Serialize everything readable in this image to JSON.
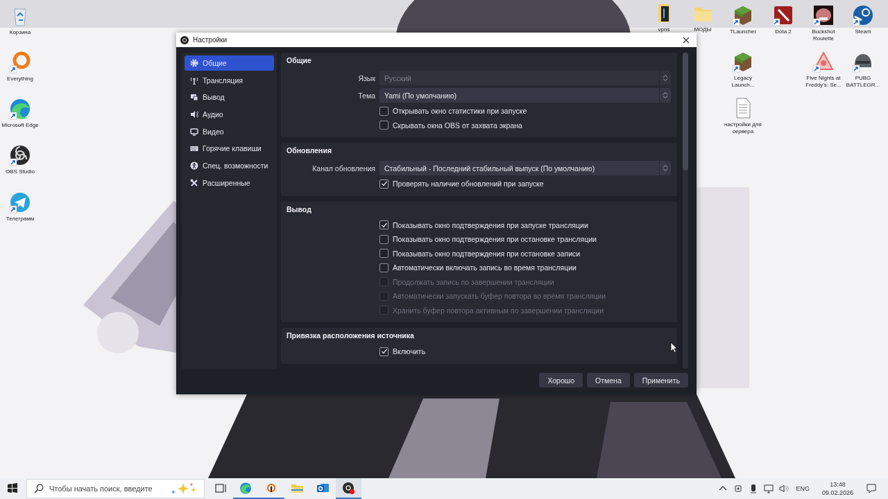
{
  "desktop_icons": [
    {
      "label": "Корзина",
      "kind": "recycle",
      "shortcut": false
    },
    {
      "label": "Everything",
      "kind": "ring",
      "shortcut": true
    },
    {
      "label": "Microsoft Edge",
      "kind": "wave",
      "shortcut": true
    },
    {
      "label": "OBS Studio",
      "kind": "blades",
      "shortcut": true
    },
    {
      "label": "Телеграмм",
      "kind": "plane",
      "shortcut": true
    },
    {
      "label": "vpns",
      "kind": "book",
      "shortcut": false
    },
    {
      "label": "МОДЫ",
      "kind": "folder",
      "shortcut": false
    },
    {
      "label": "TLauncher",
      "kind": "block",
      "shortcut": true
    },
    {
      "label": "Dota 2",
      "kind": "redtile",
      "shortcut": true
    },
    {
      "label": "Buckshot Roulette",
      "kind": "emblem",
      "shortcut": true
    },
    {
      "label": "Steam",
      "kind": "piston",
      "shortcut": true
    },
    {
      "label": "Legacy Launch...",
      "kind": "block",
      "shortcut": true
    },
    {
      "label": "Five Nights at Freddy's: Se...",
      "kind": "triangle",
      "shortcut": true
    },
    {
      "label": "PUBG BATTLEGR...",
      "kind": "helmet",
      "shortcut": true
    },
    {
      "label": "настройки для сервера",
      "kind": "document",
      "shortcut": false
    }
  ],
  "settings_window": {
    "title": "Настройки",
    "sidebar": [
      {
        "label": "Общие",
        "kind": "gear",
        "selected": true
      },
      {
        "label": "Трансляция",
        "kind": "antenna",
        "selected": false
      },
      {
        "label": "Вывод",
        "kind": "output",
        "selected": false
      },
      {
        "label": "Аудио",
        "kind": "speaker",
        "selected": false
      },
      {
        "label": "Видео",
        "kind": "monitor",
        "selected": false
      },
      {
        "label": "Горячие клавиши",
        "kind": "keyboard",
        "selected": false
      },
      {
        "label": "Спец. возможности",
        "kind": "person",
        "selected": false
      },
      {
        "label": "Расширенные",
        "kind": "tools",
        "selected": false
      }
    ],
    "sections": [
      {
        "title": "Общие",
        "rows": [
          {
            "kind": "select",
            "label": "Язык",
            "value": "Русский",
            "disabled": true
          },
          {
            "kind": "select",
            "label": "Тема",
            "value": "Yami (По умолчанию)",
            "disabled": false
          },
          {
            "kind": "checkbox",
            "label": "Открывать окно статистики при запуске",
            "checked": false,
            "disabled": false
          },
          {
            "kind": "checkbox",
            "label": "Скрывать окна OBS от захвата экрана",
            "checked": false,
            "disabled": false
          }
        ]
      },
      {
        "title": "Обновления",
        "rows": [
          {
            "kind": "select",
            "label": "Канал обновления",
            "value": "Стабильный - Последний стабильный выпуск (По умолчанию)",
            "disabled": false
          },
          {
            "kind": "checkbox",
            "label": "Проверять наличие обновлений при запуске",
            "checked": true,
            "disabled": false
          }
        ]
      },
      {
        "title": "Вывод",
        "rows": [
          {
            "kind": "checkbox",
            "label": "Показывать окно подтверждения при запуске трансляции",
            "checked": true,
            "disabled": false
          },
          {
            "kind": "checkbox",
            "label": "Показывать окно подтверждения при остановке трансляции",
            "checked": false,
            "disabled": false
          },
          {
            "kind": "checkbox",
            "label": "Показывать окно подтверждения при остановке записи",
            "checked": false,
            "disabled": false
          },
          {
            "kind": "checkbox",
            "label": "Автоматически включать запись во время трансляции",
            "checked": false,
            "disabled": false
          },
          {
            "kind": "checkbox",
            "label": "Продолжать запись по завершении трансляции",
            "checked": false,
            "disabled": true
          },
          {
            "kind": "checkbox",
            "label": "Автоматически запускать буфер повтора во время трансляции",
            "checked": false,
            "disabled": true
          },
          {
            "kind": "checkbox",
            "label": "Хранить буфер повтора активным по завершении трансляции",
            "checked": false,
            "disabled": true
          }
        ]
      },
      {
        "title": "Привязка расположения источника",
        "rows": [
          {
            "kind": "checkbox",
            "label": "Включить",
            "checked": true,
            "disabled": false
          }
        ]
      }
    ],
    "buttons": [
      "Хорошо",
      "Отмена",
      "Применить"
    ]
  },
  "taskbar": {
    "search": {
      "placeholder": "Чтобы начать поиск, введите"
    },
    "apps": [
      {
        "kind": "taskview",
        "running": false,
        "selected": false
      },
      {
        "kind": "wave",
        "running": true,
        "selected": false
      },
      {
        "kind": "ring",
        "running": true,
        "selected": false
      },
      {
        "kind": "folder",
        "running": false,
        "selected": false
      },
      {
        "kind": "mail",
        "running": false,
        "selected": false
      },
      {
        "kind": "blades",
        "running": true,
        "selected": true
      }
    ],
    "language": "ENG",
    "time": "13:48",
    "date": "09.02.2026"
  }
}
